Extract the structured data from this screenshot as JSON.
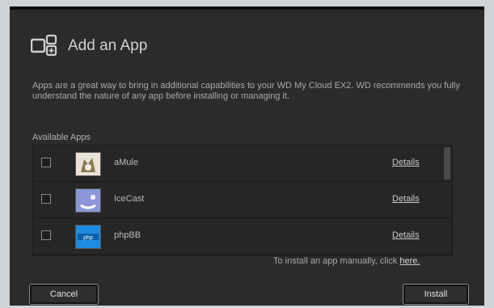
{
  "dialog": {
    "title": "Add an App",
    "description": "Apps are a great way to bring in additional capabilities to your WD My Cloud EX2. WD recommends you fully understand the nature of any app before installing or managing it.",
    "available_label": "Available Apps",
    "apps": [
      {
        "name": "aMule",
        "details_label": "Details",
        "checked": false
      },
      {
        "name": "IceCast",
        "details_label": "Details",
        "checked": false
      },
      {
        "name": "phpBB",
        "details_label": "Details",
        "checked": false
      }
    ],
    "manual_text": "To install an app manually, click",
    "manual_link": "here.",
    "cancel_label": "Cancel",
    "install_label": "Install"
  }
}
